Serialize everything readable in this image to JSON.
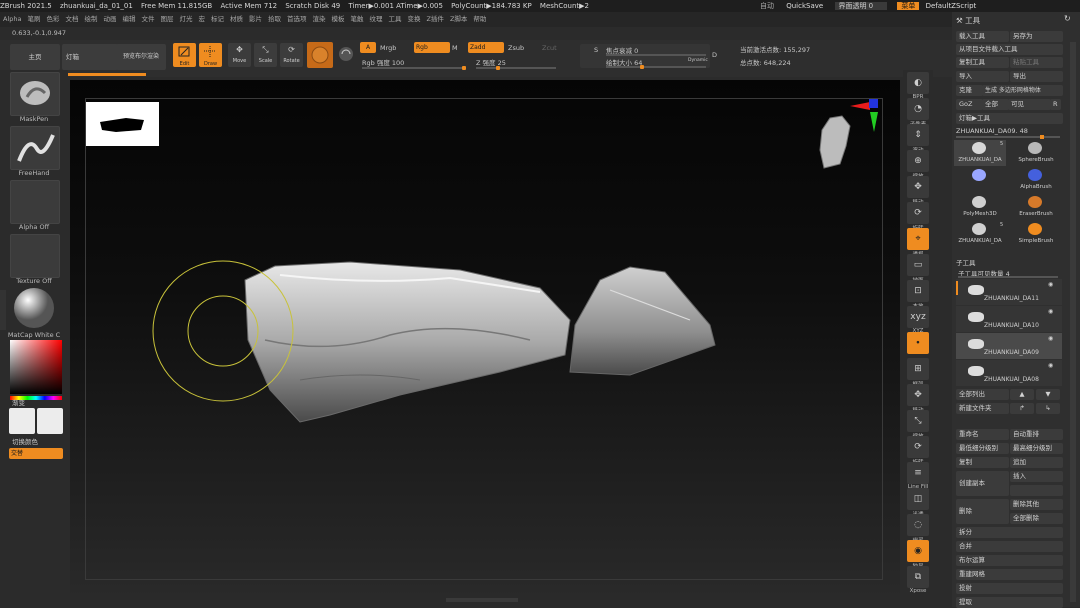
{
  "titlebar": {
    "app": "ZBrush 2021.5",
    "file": "zhuankuai_da_01_01",
    "free_mem": "Free Mem 11.815GB",
    "active_mem": "Active Mem 712",
    "scratch": "Scratch Disk 49",
    "timer": "Timer▶0.001 ATime▶0.005",
    "polycount": "PolyCount▶184.783 KP",
    "meshcount": "MeshCount▶2",
    "auto": "自动",
    "quicksave": "QuickSave",
    "transparency": "界面透明 0",
    "menu": "菜单",
    "script": "DefaultZScript"
  },
  "menus": [
    "Alpha",
    "笔刷",
    "色彩",
    "文档",
    "绘制",
    "动画",
    "编辑",
    "文件",
    "图层",
    "灯光",
    "宏",
    "标记",
    "材质",
    "影片",
    "拾取",
    "首选项",
    "渲染",
    "模板",
    "笔触",
    "纹理",
    "工具",
    "变换",
    "Z插件",
    "Z脚本",
    "帮助"
  ],
  "coords": "0.633,-0.1,0.947",
  "toolbar": {
    "tab_home": "主页",
    "tab_lightbox": "灯箱",
    "tab_preview": "预览布尔渲染",
    "edit": "Edit",
    "draw": "Draw",
    "move": "Move",
    "scale": "Scale",
    "rotate": "Rotate",
    "a_label": "A",
    "mrgb": "Mrgb",
    "rgb": "Rgb",
    "m_label": "M",
    "zadd": "Zadd",
    "zsub": "Zsub",
    "zcut": "Zcut",
    "rgb_intensity": "Rgb 强度 100",
    "z_intensity": "Z 强度 25",
    "focal_shift": "焦点衰减 0",
    "draw_size": "绘制大小 64",
    "dynamic": "Dynamic",
    "active_points": "当前激活点数: 155,297",
    "total_points": "总点数: 648,224",
    "s_label": "S",
    "d_label": "D"
  },
  "leftpanel": {
    "brush": "MaskPen",
    "stroke": "FreeHand",
    "alpha": "Alpha Off",
    "texture": "Texture Off",
    "material": "MatCap White C",
    "gradient": "渐变",
    "switch_color": "切换颜色",
    "alternate": "交替"
  },
  "rightcol": [
    "BPR",
    "子像素",
    "滚动",
    "缩放",
    "移动",
    "旋转",
    "透视",
    "地面",
    "本地",
    "XYZ",
    "",
    "框架",
    "移动",
    "缩放",
    "旋转",
    "Line Fill",
    "半透",
    "幽灵",
    "独显",
    "Xpose"
  ],
  "tool_panel": {
    "title": "工具",
    "load_tool": "载入工具",
    "save_as": "另存为",
    "load_from_project": "从项目文件载入工具",
    "copy_tool": "复制工具",
    "paste_tool": "粘贴工具",
    "import": "导入",
    "export": "导出",
    "clone": "克隆",
    "make_polymesh": "生成 多边形网格物体",
    "goz": "GoZ",
    "all": "全部",
    "visible": "可见",
    "r_label": "R",
    "lightbox_tools": "灯箱▶工具",
    "current_tool": "ZHUANKUAI_DA09. 48",
    "tools": [
      {
        "name": "ZHUANKUAI_DA",
        "badge": "5"
      },
      {
        "name": "SphereBrush",
        "badge": ""
      },
      {
        "name": "",
        "badge": ""
      },
      {
        "name": "AlphaBrush",
        "badge": ""
      },
      {
        "name": "PolyMesh3D",
        "badge": ""
      },
      {
        "name": "EraserBrush",
        "badge": ""
      },
      {
        "name": "ZHUANKUAI_DA",
        "badge": "5"
      },
      {
        "name": "SimpleBrush",
        "badge": ""
      }
    ],
    "subtool": "子工具",
    "subtool_count": "子工具可见数量 4",
    "subtools": [
      "ZHUANKUAI_DA11",
      "ZHUANKUAI_DA10",
      "ZHUANKUAI_DA09",
      "ZHUANKUAI_DA08"
    ],
    "list_all": "全部列出",
    "new_folder": "新建文件夹",
    "rename": "重命名",
    "auto_reorder": "自动重排",
    "lowest_res": "最低细分级别",
    "highest_res": "最高细分级别",
    "duplicate": "复制",
    "append": "追加",
    "create_copy": "创建副本",
    "insert": "插入",
    "delete": "删除",
    "delete_others": "删除其他",
    "delete_all": "全部删除",
    "split": "拆分",
    "merge": "合并",
    "boolean": "布尔运算",
    "remesh": "重建网格",
    "project": "投射",
    "extract": "提取"
  }
}
